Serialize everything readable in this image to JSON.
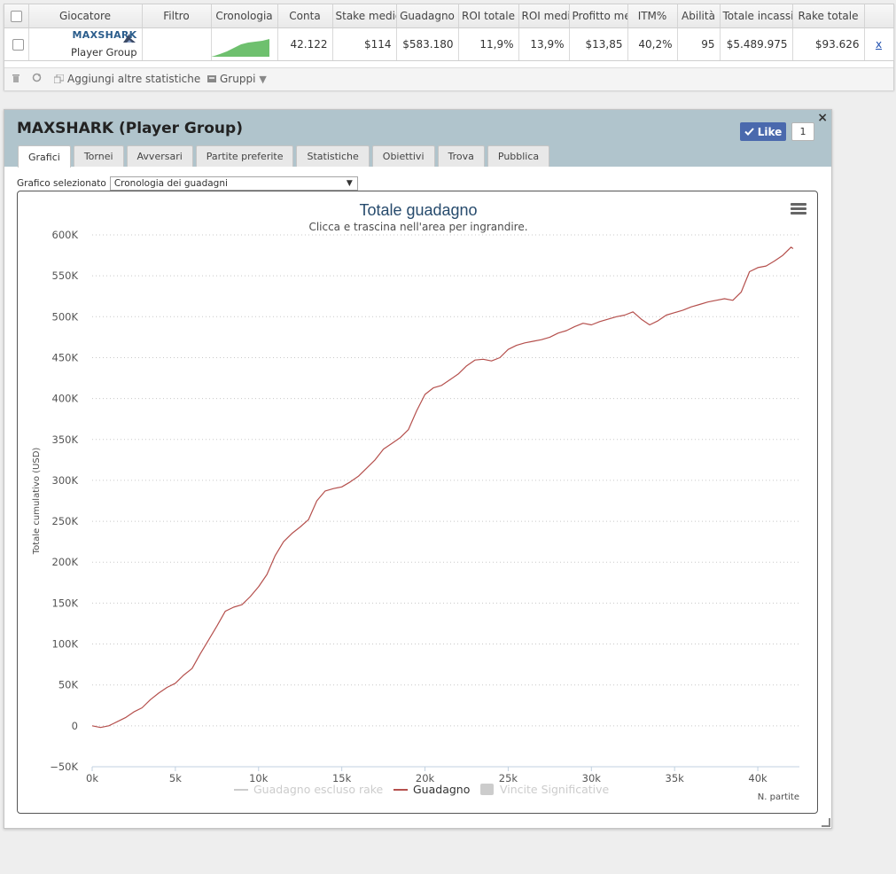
{
  "table": {
    "headers": [
      "",
      "Giocatore",
      "Filtro",
      "Cronologia",
      "Conta",
      "Stake medio",
      "Guadagno",
      "ROI totale",
      "ROI medio",
      "Profitto medio",
      "ITM%",
      "Abilità",
      "Totale incassi",
      "Rake totale",
      ""
    ],
    "row": {
      "player_name": "MAXSHARK",
      "player_sub": "Player Group",
      "filter": "",
      "count": "42.122",
      "avg_stake": "$114",
      "profit": "$583.180",
      "roi_total": "11,9%",
      "roi_avg": "13,9%",
      "avg_profit": "$13,85",
      "itm": "40,2%",
      "ability": "95",
      "total_income": "$5.489.975",
      "rake_total": "$93.626",
      "remove_label": "x"
    }
  },
  "toolbar": {
    "add_stats_label": "Aggiungi altre statistiche",
    "groups_label": "Gruppi"
  },
  "panel": {
    "title": "MAXSHARK (Player Group)",
    "like_label": "Like",
    "like_count": "1",
    "close_label": "×",
    "tabs": [
      "Grafici",
      "Tornei",
      "Avversari",
      "Partite preferite",
      "Statistiche",
      "Obiettivi",
      "Trova",
      "Pubblica"
    ],
    "active_tab": 0,
    "select_label": "Grafico selezionato",
    "select_value": "Cronologia dei guadagni"
  },
  "colors": {
    "series_line": "#b5504d",
    "header_bg": "#b0c4cc",
    "like_bg": "#4a69ad",
    "spark_fill": "#6ec06e"
  },
  "chart_data": {
    "type": "line",
    "title": "Totale guadagno",
    "subtitle": "Clicca e trascina nell'area per ingrandire.",
    "xlabel": "N. partite",
    "ylabel": "Totale cumulativo (USD)",
    "xlim": [
      0,
      42122
    ],
    "ylim": [
      -50000,
      600000
    ],
    "x_ticks": [
      "0k",
      "5k",
      "10k",
      "15k",
      "20k",
      "25k",
      "30k",
      "35k",
      "40k"
    ],
    "y_ticks": [
      "600K",
      "550K",
      "500K",
      "450K",
      "400K",
      "350K",
      "300K",
      "250K",
      "200K",
      "150K",
      "100K",
      "50K",
      "0",
      "−50K"
    ],
    "legend": [
      "Guadagno escluso rake",
      "Guadagno",
      "Vincite Significative"
    ],
    "legend_position": "bottom",
    "grid": true,
    "series": [
      {
        "name": "Guadagno",
        "x": [
          0,
          500,
          1000,
          1500,
          2000,
          2500,
          3000,
          3500,
          4000,
          4500,
          5000,
          5500,
          6000,
          6500,
          7000,
          7500,
          8000,
          8500,
          9000,
          9500,
          10000,
          10500,
          11000,
          11500,
          12000,
          12500,
          13000,
          13500,
          14000,
          14500,
          15000,
          15500,
          16000,
          16500,
          17000,
          17500,
          18000,
          18500,
          19000,
          19500,
          20000,
          20500,
          21000,
          21500,
          22000,
          22500,
          23000,
          23500,
          24000,
          24500,
          25000,
          25500,
          26000,
          26500,
          27000,
          27500,
          28000,
          28500,
          29000,
          29500,
          30000,
          30500,
          31000,
          31500,
          32000,
          32500,
          33000,
          33500,
          34000,
          34500,
          35000,
          35500,
          36000,
          36500,
          37000,
          37500,
          38000,
          38500,
          39000,
          39500,
          40000,
          40500,
          41000,
          41500,
          42000,
          42122
        ],
        "values": [
          0,
          -2000,
          0,
          5000,
          10000,
          17000,
          22000,
          32000,
          40000,
          47000,
          52000,
          62000,
          70000,
          88000,
          105000,
          122000,
          140000,
          145000,
          148000,
          158000,
          170000,
          185000,
          208000,
          225000,
          235000,
          243000,
          252000,
          275000,
          287000,
          290000,
          292000,
          298000,
          305000,
          315000,
          325000,
          338000,
          345000,
          352000,
          362000,
          385000,
          405000,
          413000,
          416000,
          423000,
          430000,
          440000,
          447000,
          448000,
          446000,
          450000,
          460000,
          465000,
          468000,
          470000,
          472000,
          475000,
          480000,
          483000,
          488000,
          492000,
          490000,
          494000,
          497000,
          500000,
          502000,
          506000,
          497000,
          490000,
          495000,
          502000,
          505000,
          508000,
          512000,
          515000,
          518000,
          520000,
          522000,
          520000,
          530000,
          555000,
          560000,
          562000,
          568000,
          575000,
          585000,
          583180
        ]
      }
    ]
  }
}
